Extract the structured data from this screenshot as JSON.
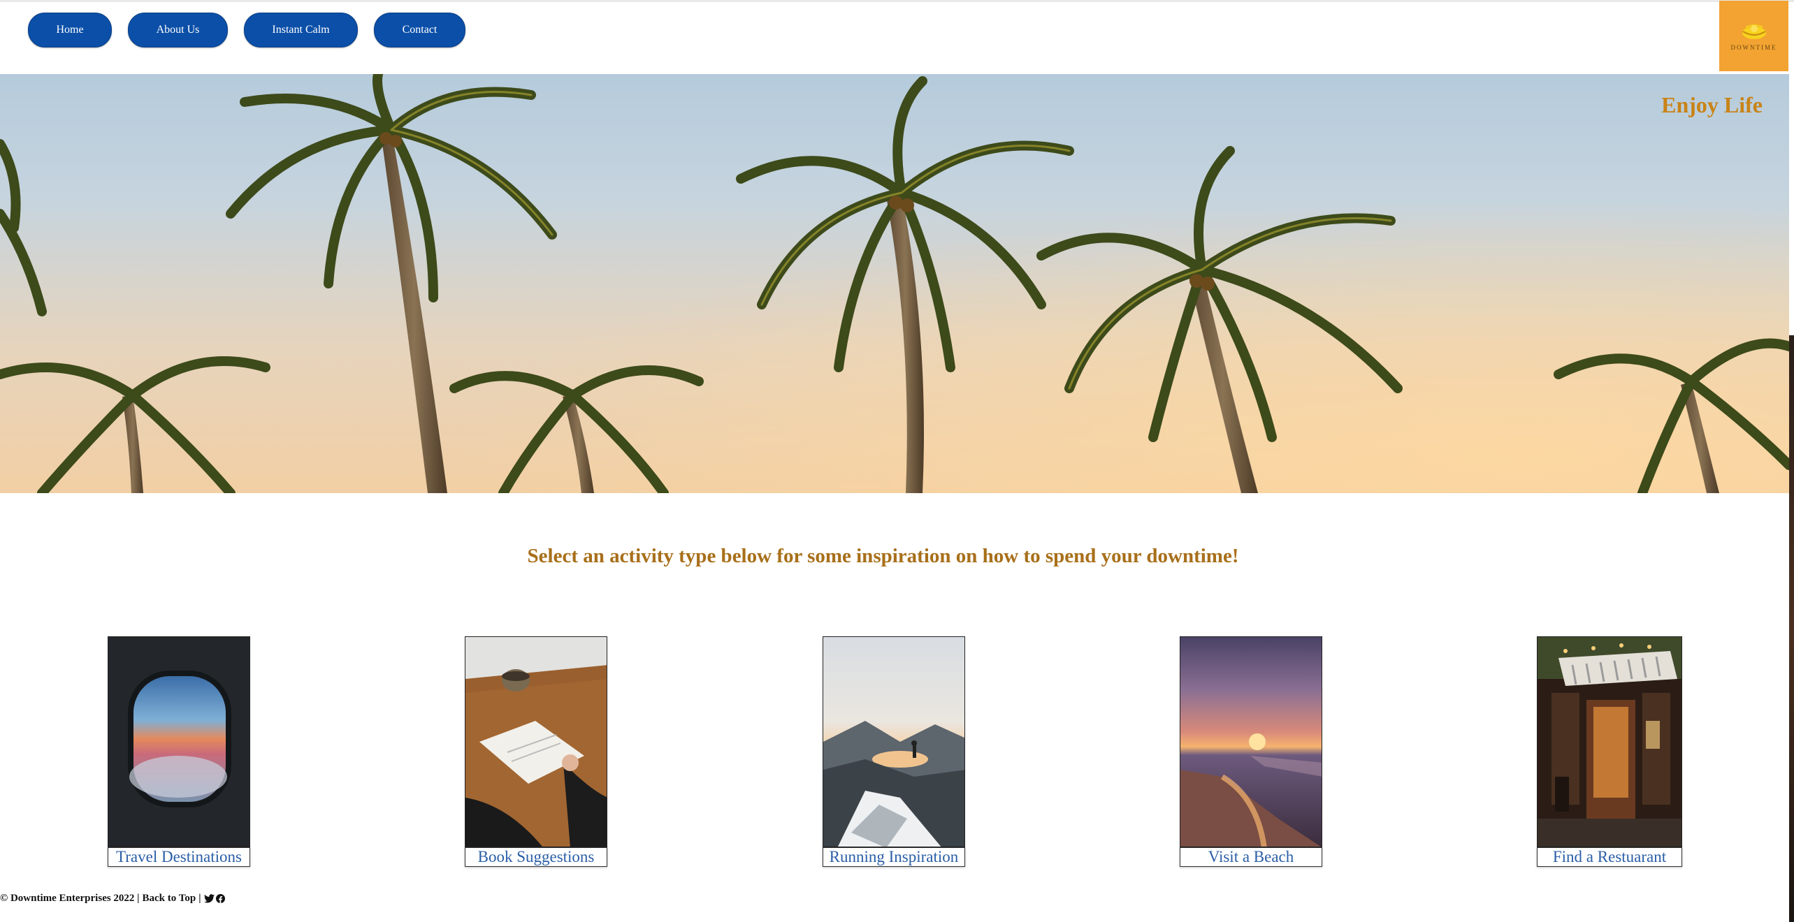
{
  "nav": {
    "items": [
      {
        "label": "Home"
      },
      {
        "label": "About Us"
      },
      {
        "label": "Instant Calm"
      },
      {
        "label": "Contact"
      }
    ],
    "logo_text": "DOWNTIME"
  },
  "hero": {
    "tagline": "Enjoy Life"
  },
  "main": {
    "prompt": "Select an activity type below for some inspiration on how to spend your downtime!",
    "cards": [
      {
        "label": "Travel Destinations"
      },
      {
        "label": "Book Suggestions"
      },
      {
        "label": "Running Inspiration"
      },
      {
        "label": "Visit a Beach"
      },
      {
        "label": "Find a Restuarant"
      }
    ]
  },
  "footer": {
    "copyright": "© Downtime Enterprises 2022 |",
    "back_to_top": "Back to Top",
    "separator": "|",
    "icons": [
      "twitter-icon",
      "facebook-icon"
    ]
  },
  "colors": {
    "nav_button": "#0b4fa8",
    "logo_bg": "#f2a331",
    "accent_text": "#c98316",
    "link_text": "#2a5ea6"
  }
}
